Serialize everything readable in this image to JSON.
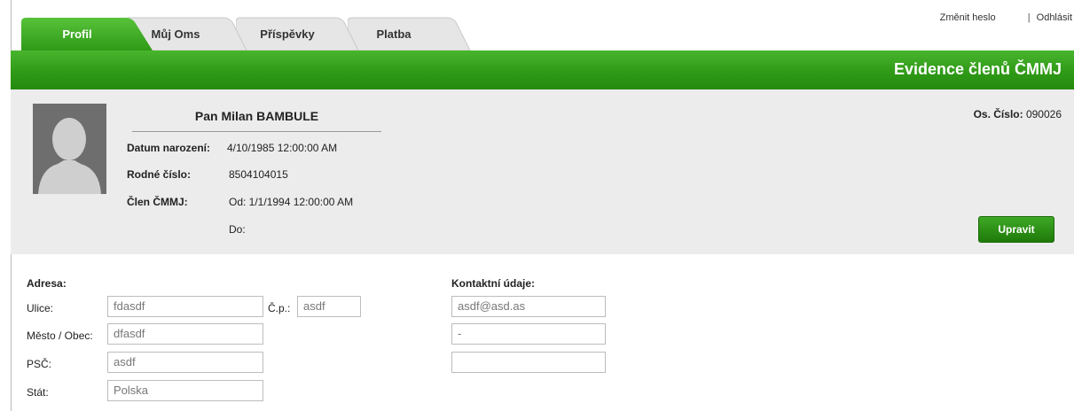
{
  "tabs": [
    {
      "label": "Profil",
      "active": true
    },
    {
      "label": "Můj Oms",
      "active": false
    },
    {
      "label": "Příspěvky",
      "active": false
    },
    {
      "label": "Platba",
      "active": false
    }
  ],
  "toplinks": {
    "change_password": "Změnit heslo",
    "separator": "|",
    "logout": "Odhlásit"
  },
  "header": {
    "title": "Evidence členů ČMMJ"
  },
  "profile": {
    "name": "Pan Milan BAMBULE",
    "birth_label": "Datum narození:",
    "birth_value": "4/10/1985 12:00:00 AM",
    "rc_label": "Rodné číslo:",
    "rc_value": "8504104015",
    "member_label": "Člen ČMMJ:",
    "member_from": "Od: 1/1/1994 12:00:00 AM",
    "member_to": "Do:",
    "os_label": "Os. Číslo:",
    "os_value": "090026",
    "edit_button": "Upravit"
  },
  "address": {
    "heading": "Adresa:",
    "street_label": "Ulice:",
    "street_value": "fdasdf",
    "cp_label": "Č.p.:",
    "cp_value": "asdf",
    "city_label": "Město / Obec:",
    "city_value": "dfasdf",
    "zip_label": "PSČ:",
    "zip_value": "asdf",
    "country_label": "Stát:",
    "country_value": "Polska"
  },
  "contact": {
    "heading": "Kontaktní údaje:",
    "email_value": "asdf@asd.as",
    "phone_value": "-",
    "other_value": ""
  },
  "colors": {
    "accent_green": "#2f9a17",
    "panel_bg": "#ececec"
  }
}
